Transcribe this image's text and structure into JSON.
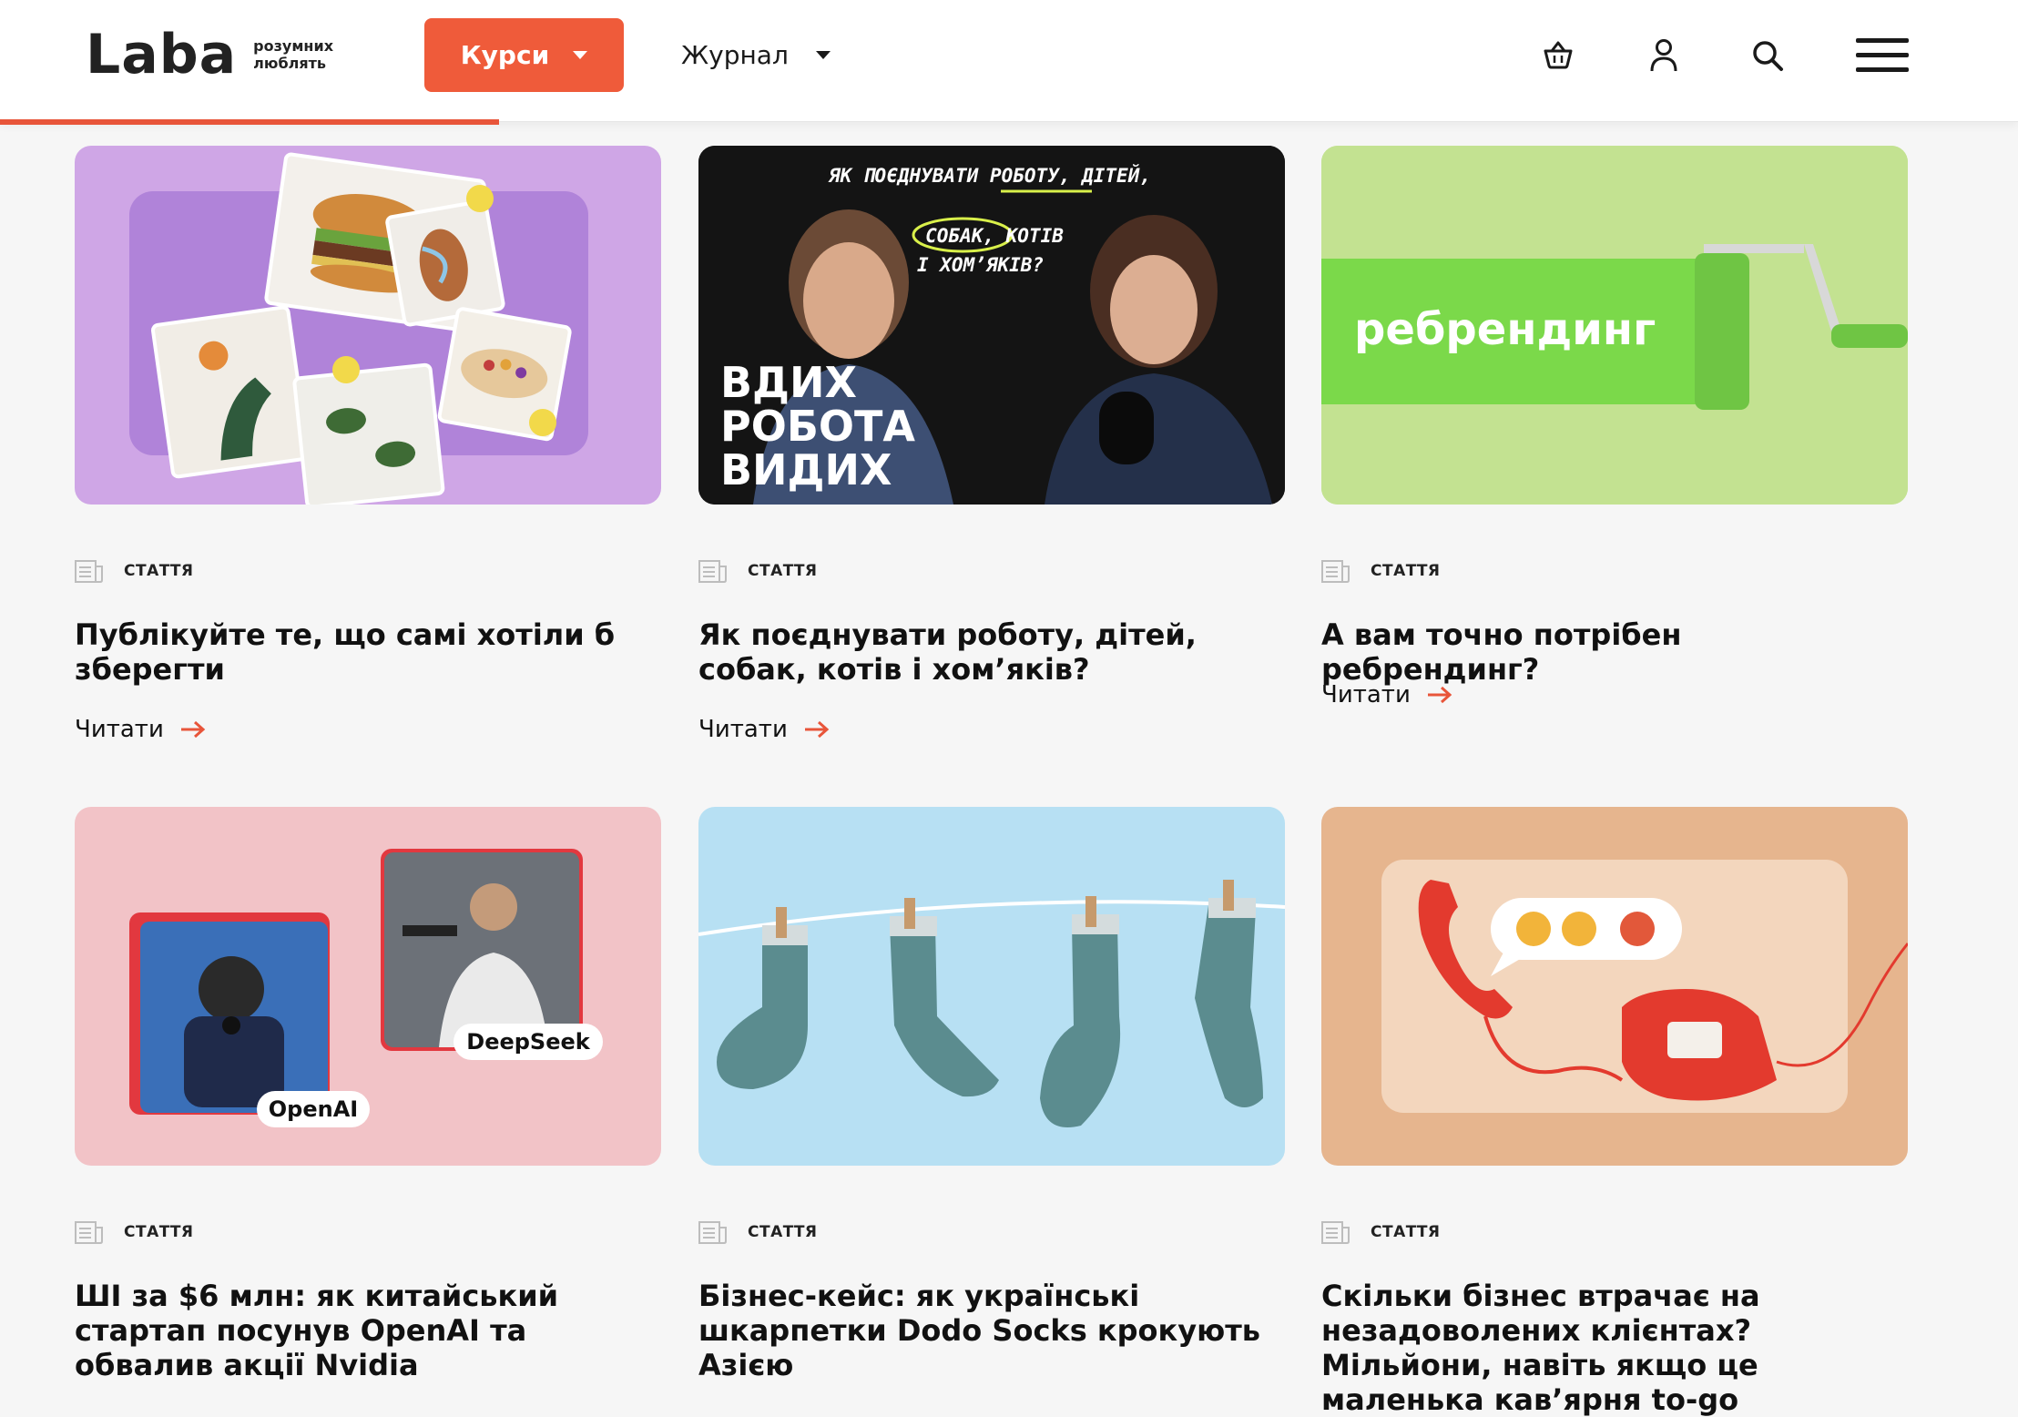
{
  "header": {
    "logo_word": "Laba",
    "logo_tag_line1": "розумних",
    "logo_tag_line2": "люблять",
    "courses_label": "Курси",
    "journal_label": "Журнал"
  },
  "colors": {
    "accent": "#ef5b3a",
    "card1_bg": "#cfa6e6",
    "card2_bg": "#111111",
    "card3_bg": "#bfe18e",
    "card4_bg": "#f2c3c7",
    "card5_bg": "#b7e0f3",
    "card6_bg": "#e6b58e"
  },
  "cards": [
    {
      "type": "СТАТТЯ",
      "title": "Публікуйте те, що самі хотіли б зберегти",
      "read": "Читати"
    },
    {
      "type": "СТАТТЯ",
      "title": "Як поєднувати роботу, дітей, собак, котів і хом’яків?",
      "read": "Читати",
      "image_text": {
        "headline": "ЯК ПОЄДНУВАТИ РОБОТУ, ДІТЕЙ,",
        "line2": "СОБАК, КОТІВ",
        "line3": "І ХОМ’ЯКІВ?",
        "big1": "ВДИХ",
        "big2": "РОБОТА",
        "big3": "ВИДИХ"
      }
    },
    {
      "type": "СТАТТЯ",
      "title": "А вам точно потрібен ребрендинг?",
      "read": "Читати",
      "image_text": {
        "word": "ребрендинг"
      }
    },
    {
      "type": "СТАТТЯ",
      "title": "ШІ за $6 млн: як китайський стартап посунув OpenAI та обвалив акції Nvidia",
      "image_text": {
        "tag1": "OpenAI",
        "tag2": "DeepSeek"
      }
    },
    {
      "type": "СТАТТЯ",
      "title": "Бізнес-кейс: як українські шкарпетки Dodo Socks крокують Азією"
    },
    {
      "type": "СТАТТЯ",
      "title": "Скільки бізнес втрачає на незадоволених клієнтах? Мільйони, навіть якщо це маленька кав’ярня to-go"
    }
  ]
}
